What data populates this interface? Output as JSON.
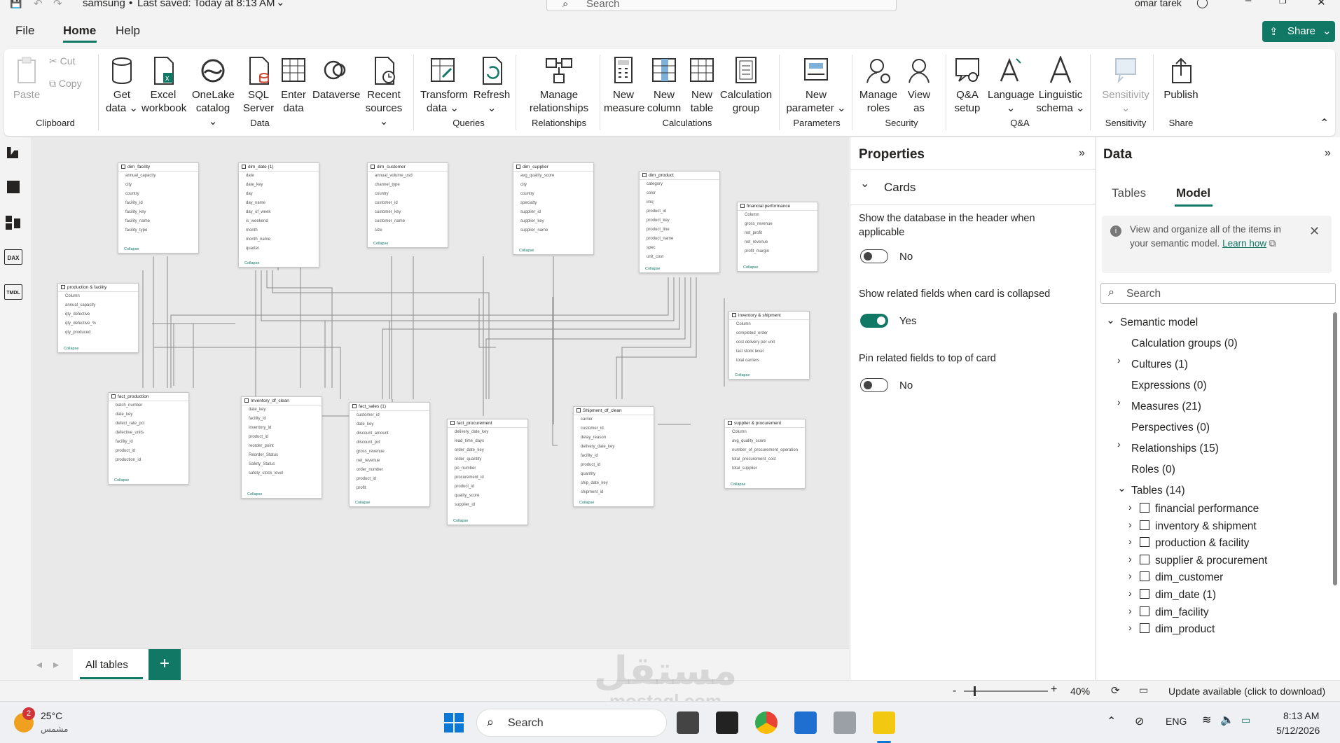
{
  "titlebar": {
    "file_name": "samsung",
    "saved_status": "Last saved: Today at 8:13 AM",
    "search_placeholder": "Search",
    "user": "omar tarek"
  },
  "menu": {
    "file": "File",
    "home": "Home",
    "help": "Help",
    "share": "Share"
  },
  "ribbon": {
    "clipboard": {
      "paste": "Paste",
      "cut": "Cut",
      "copy": "Copy",
      "group": "Clipboard"
    },
    "data": {
      "get_data": "Get data",
      "excel": "Excel workbook",
      "onelake": "OneLake catalog",
      "sql": "SQL Server",
      "enter_data": "Enter data",
      "dataverse": "Dataverse",
      "recent": "Recent sources",
      "group": "Data"
    },
    "queries": {
      "transform": "Transform data",
      "refresh": "Refresh",
      "group": "Queries"
    },
    "relationships": {
      "manage": "Manage relationships",
      "group": "Relationships"
    },
    "calculations": {
      "new_measure": "New measure",
      "new_column": "New column",
      "new_table": "New table",
      "calc_group": "Calculation group",
      "group": "Calculations"
    },
    "parameters": {
      "new_param": "New parameter",
      "group": "Parameters"
    },
    "security": {
      "manage_roles": "Manage roles",
      "view_as": "View as",
      "group": "Security"
    },
    "qa": {
      "qa_setup": "Q&A setup",
      "language": "Language",
      "linguistic": "Linguistic schema",
      "group": "Q&A"
    },
    "sensitivity": {
      "label": "Sensitivity",
      "group": "Sensitivity"
    },
    "share": {
      "publish": "Publish",
      "group": "Share"
    }
  },
  "left_rail": {
    "dax": "DAX",
    "tmdl": "TMDL"
  },
  "model_cards": [
    {
      "name": "dim_facility",
      "rows": [
        "annual_capacity",
        "city",
        "country",
        "facility_id",
        "facility_key",
        "facility_name",
        "facility_type"
      ],
      "collapse": "Collapse"
    },
    {
      "name": "dim_date (1)",
      "rows": [
        "date",
        "date_key",
        "day",
        "day_name",
        "day_of_week",
        "is_weekend",
        "month",
        "month_name",
        "quarter"
      ],
      "collapse": "Collapse"
    },
    {
      "name": "dim_customer",
      "rows": [
        "annual_volume_usd",
        "channel_type",
        "country",
        "customer_id",
        "customer_key",
        "customer_name",
        "size"
      ],
      "collapse": "Collapse"
    },
    {
      "name": "dim_supplier",
      "rows": [
        "avg_quality_score",
        "city",
        "country",
        "specialty",
        "supplier_id",
        "supplier_key",
        "supplier_name"
      ],
      "collapse": "Collapse"
    },
    {
      "name": "dim_product",
      "rows": [
        "category",
        "color",
        "imq",
        "product_id",
        "product_key",
        "product_line",
        "product_name",
        "spec",
        "unit_cost"
      ],
      "collapse": "Collapse"
    },
    {
      "name": "financial performance",
      "rows": [
        "Column",
        "gross_revenue",
        "net_profit",
        "net_revenue",
        "profit_margin"
      ],
      "collapse": "Collapse"
    },
    {
      "name": "production & facility",
      "rows": [
        "Column",
        "annual_capacity",
        "qty_defective",
        "qty_defective_%",
        "qty_produced"
      ],
      "collapse": "Collapse"
    },
    {
      "name": "inventory & shipment",
      "rows": [
        "Column",
        "completed_order",
        "cost delivery per unit",
        "last stock level",
        "total carriers"
      ],
      "collapse": "Collapse"
    },
    {
      "name": "fact_production",
      "rows": [
        "batch_number",
        "date_key",
        "defect_rate_pct",
        "defective_units",
        "facility_id",
        "product_id",
        "production_id"
      ],
      "collapse": "Collapse"
    },
    {
      "name": "Inventory_df_clean",
      "rows": [
        "date_key",
        "facility_id",
        "inventory_id",
        "product_id",
        "reorder_point",
        "Reorder_Status",
        "Safety_Status",
        "safety_stock_level"
      ],
      "collapse": "Collapse"
    },
    {
      "name": "fact_sales (1)",
      "rows": [
        "customer_id",
        "date_key",
        "discount_amount",
        "discount_pct",
        "gross_revenue",
        "net_revenue",
        "order_number",
        "product_id",
        "profit"
      ],
      "collapse": "Collapse"
    },
    {
      "name": "fact_procurement",
      "rows": [
        "delivery_date_key",
        "lead_time_days",
        "order_date_key",
        "order_quantity",
        "po_number",
        "procurement_id",
        "product_id",
        "quality_score",
        "supplier_id"
      ],
      "collapse": "Collapse"
    },
    {
      "name": "Shipment_df_clean",
      "rows": [
        "carrier",
        "customer_id",
        "delay_reason",
        "delivery_date_key",
        "facility_id",
        "product_id",
        "quantity",
        "ship_date_key",
        "shipment_id"
      ],
      "collapse": "Collapse"
    },
    {
      "name": "supplier & procurement",
      "rows": [
        "Column",
        "avg_quality_score",
        "number_of_procurement_operation",
        "total_procurement_cost",
        "total_supplier"
      ],
      "collapse": "Collapse"
    }
  ],
  "canvas_tabs": {
    "all_tables": "All tables",
    "add": "+"
  },
  "properties": {
    "title": "Properties",
    "section": "Cards",
    "opt1_label": "Show the database in the header when applicable",
    "opt1_value": "No",
    "opt2_label": "Show related fields when card is collapsed",
    "opt2_value": "Yes",
    "opt3_label": "Pin related fields to top of card",
    "opt3_value": "No"
  },
  "data_pane": {
    "title": "Data",
    "tab_tables": "Tables",
    "tab_model": "Model",
    "info_text": "View and organize all of the items in your semantic model.",
    "info_link": "Learn how",
    "search_placeholder": "Search",
    "tree": {
      "root": "Semantic model",
      "calc_groups": "Calculation groups (0)",
      "cultures": "Cultures (1)",
      "expressions": "Expressions (0)",
      "measures": "Measures (21)",
      "perspectives": "Perspectives (0)",
      "relationships": "Relationships (15)",
      "roles": "Roles (0)",
      "tables": "Tables (14)",
      "table_items": [
        "financial performance",
        "inventory & shipment",
        "production & facility",
        "supplier & procurement",
        "dim_customer",
        "dim_date (1)",
        "dim_facility",
        "dim_product"
      ]
    }
  },
  "statusbar": {
    "zoom": "40%",
    "update": "Update available (click to download)",
    "minus": "-",
    "plus": "+"
  },
  "taskbar": {
    "weather_temp": "25°C",
    "weather_desc": "مشمس",
    "weather_badge": "2",
    "search": "Search",
    "lang": "ENG",
    "time": "8:13 AM",
    "date": "5/12/2026"
  },
  "watermark": {
    "arabic": "مستقل",
    "latin": "mostaql.com"
  },
  "colors": {
    "accent": "#117865",
    "toggle_on": "#117865"
  }
}
